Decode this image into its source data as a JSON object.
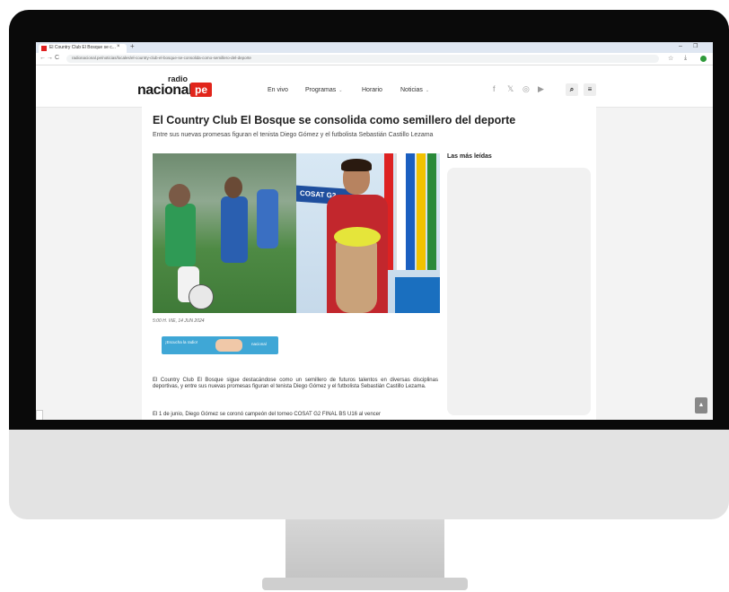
{
  "browser": {
    "tab_title": "El Country Club El Bosque se c...",
    "tab_close": "×",
    "new_tab": "+",
    "window_minimize": "–",
    "window_maximize": "❐",
    "back": "←",
    "forward": "→",
    "reload": "C",
    "site_info": "⇆",
    "url": "radionacional.pe/noticias/locales/el-country-club-el-bosque-se-consolida-como-semillero-del-deporte",
    "bookmark_icon": "☆",
    "download_icon": "⤓"
  },
  "site": {
    "logo_top": "radio",
    "logo_main": "nacional",
    "logo_badge": "pe",
    "menu": [
      {
        "label": "En vivo",
        "chevron": ""
      },
      {
        "label": "Programas",
        "chevron": "⌄"
      },
      {
        "label": "Horario",
        "chevron": ""
      },
      {
        "label": "Noticias",
        "chevron": "⌄"
      }
    ],
    "social_icons": [
      "facebook-icon",
      "x-icon",
      "instagram-icon",
      "youtube-icon"
    ],
    "social_glyphs": [
      "f",
      "𝕏",
      "◎",
      "▶"
    ],
    "search_glyph": "⌕",
    "menu_glyph": "≡"
  },
  "article": {
    "headline": "El Country Club El Bosque se consolida como semillero del deporte",
    "subheadline": "Entre sus nuevas promesas figuran el tenista Diego Gómez y el futbolista Sebastián Castillo Lezama",
    "photo_banner": "COSAT G2",
    "dateline": "5:00 H. VIE, 14 JUN 2024",
    "ad_text": "¡Escucha la radio!",
    "ad_logo": "nacional",
    "paragraphs": [
      "El Country Club El Bosque sigue destacándose como un semillero de futuros talentos en diversas disciplinas deportivas, y entre sus nuevas promesas figuran el tenista Diego Gómez y el futbolista Sebastián Castillo Lezama.",
      "El 1 de junio, Diego Gómez se coronó campeón del torneo COSAT G2 FINAL BS U16 al vencer"
    ]
  },
  "sidebar": {
    "title": "Las más leídas"
  },
  "scroll_top_glyph": "▲"
}
